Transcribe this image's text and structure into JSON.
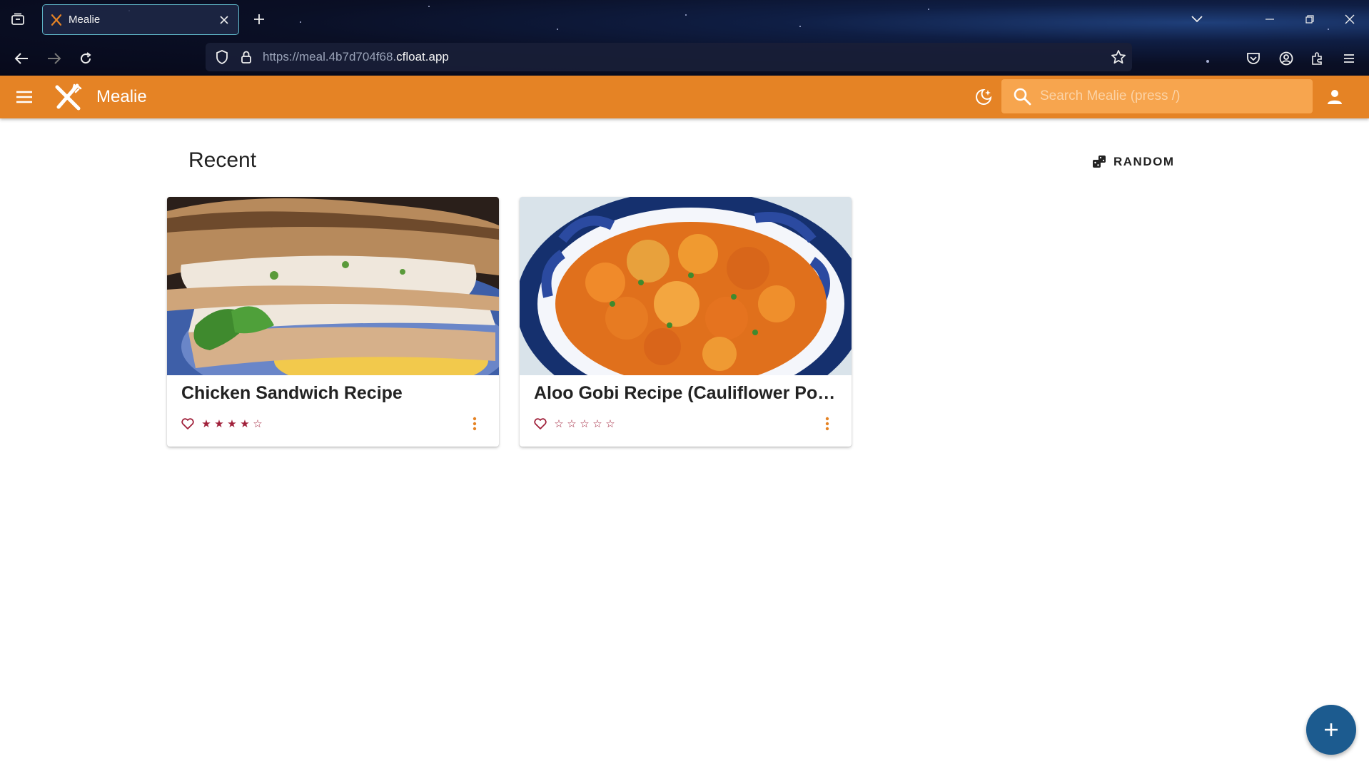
{
  "browser": {
    "tab_title": "Mealie",
    "url_prefix": "https://meal.4b7d704f68.",
    "url_host": "cfloat.app"
  },
  "app": {
    "title": "Mealie",
    "search_placeholder": "Search Mealie (press /)",
    "accent_color": "#e58325"
  },
  "main": {
    "section_title": "Recent",
    "random_label": "RANDOM",
    "recipes": [
      {
        "name": "Chicken Sandwich Recipe",
        "rating": 4,
        "max_rating": 5
      },
      {
        "name": "Aloo Gobi Recipe (Cauliflower Potato Curry)",
        "rating": 0,
        "max_rating": 5
      }
    ]
  },
  "icons": [
    "tab-list-icon",
    "mealie-favicon",
    "close-icon",
    "plus-icon",
    "chevron-down-icon",
    "minimize-icon",
    "restore-icon",
    "back-arrow-icon",
    "forward-arrow-icon",
    "reload-icon",
    "shield-icon",
    "lock-icon",
    "star-bookmark-icon",
    "pocket-icon",
    "account-icon",
    "extensions-icon",
    "hamburger-menu-icon",
    "fork-knife-logo-icon",
    "theme-toggle-icon",
    "search-icon",
    "user-icon",
    "dice-icon",
    "heart-icon",
    "more-vertical-icon"
  ]
}
